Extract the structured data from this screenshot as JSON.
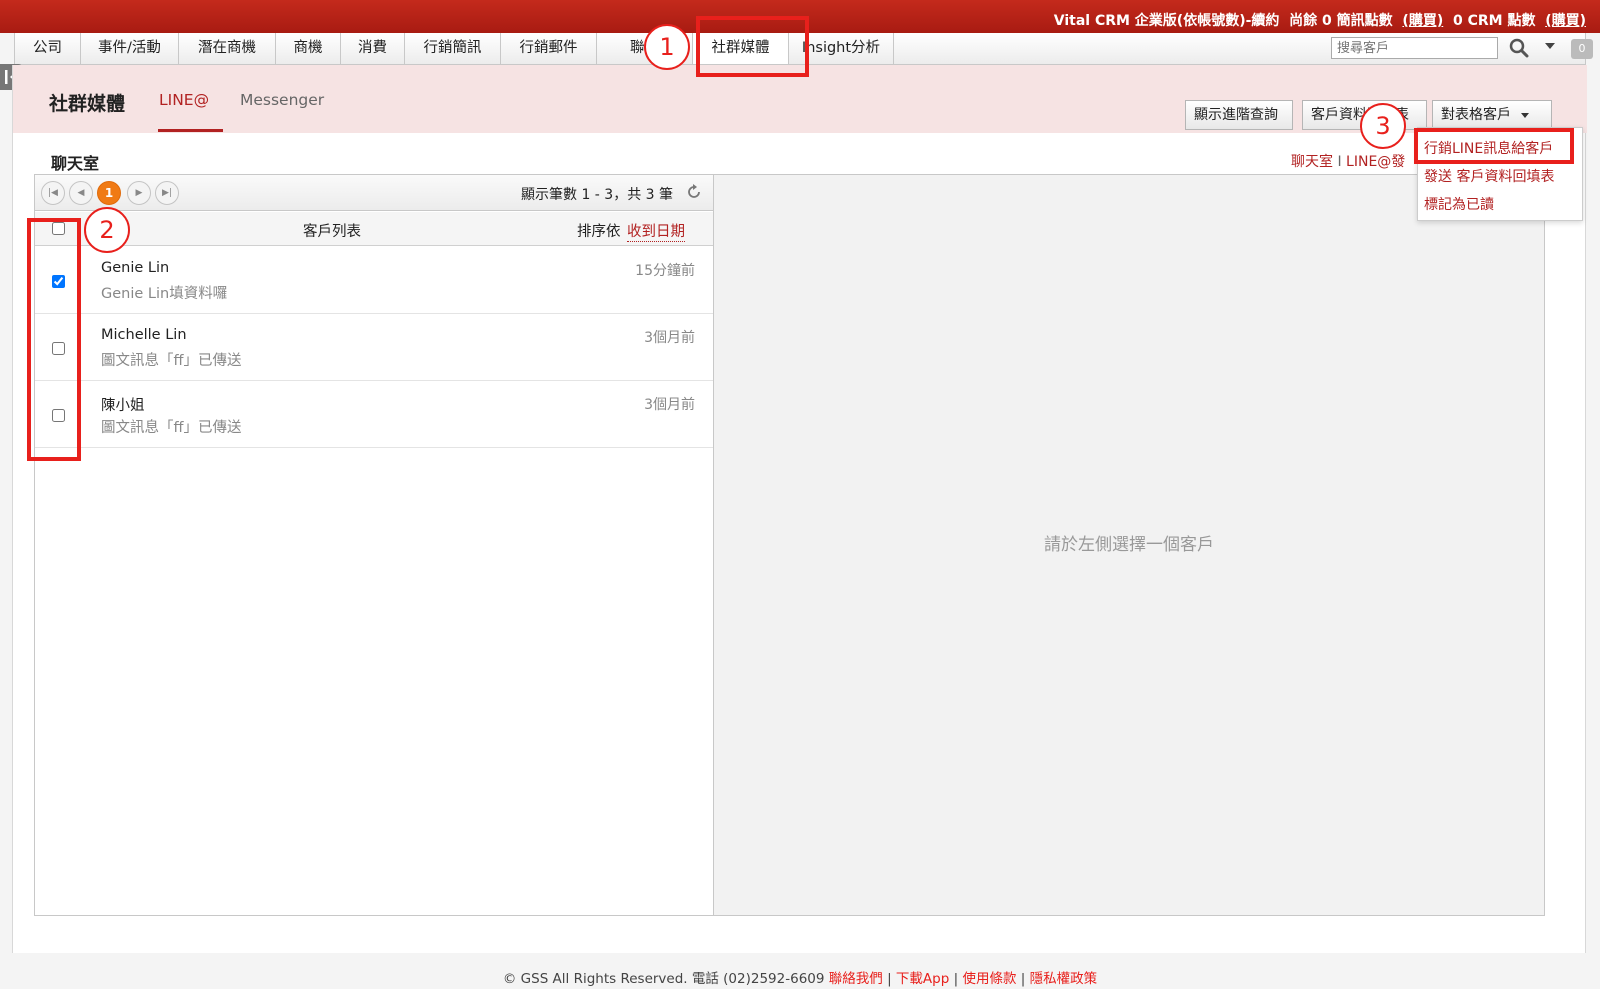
{
  "account": {
    "plan_text": "Vital CRM 企業版(依帳號數)-續約",
    "sms_prefix": "尚餘 0 簡訊點數",
    "buy1": "(購買)",
    "crm_points": "0 CRM 點數",
    "buy2": "(購買)"
  },
  "nav": {
    "tabs": [
      {
        "label": "公司"
      },
      {
        "label": "事件/活動"
      },
      {
        "label": "潛在商機"
      },
      {
        "label": "商機"
      },
      {
        "label": "消費"
      },
      {
        "label": "行銷簡訊"
      },
      {
        "label": "行銷郵件"
      },
      {
        "label": "聯繫"
      },
      {
        "label": "社群媒體"
      },
      {
        "label": "Insight分析"
      }
    ],
    "search_placeholder": "搜尋客戶",
    "badge": "0"
  },
  "subheader": {
    "title": "社群媒體",
    "tabs": [
      {
        "label": "LINE@"
      },
      {
        "label": "Messenger"
      }
    ],
    "buttons": {
      "advanced_query": "顯示進階查詢",
      "customer_form": "客戶資料回填表",
      "bulk_customers": "對表格客戶"
    }
  },
  "chat": {
    "title": "聊天室",
    "crumb": {
      "item1": "聊天室",
      "sep": "I",
      "item2": "LINE@發"
    }
  },
  "pager": {
    "current": "1",
    "count_text": "顯示筆數 1 - 3，共 3 筆"
  },
  "list": {
    "header": "客戶列表",
    "sort_label": "排序依",
    "sort_value": "收到日期",
    "rows": [
      {
        "name": "Genie Lin",
        "message": "Genie Lin填資料囉",
        "time": "15分鐘前",
        "checked": true
      },
      {
        "name": "Michelle Lin",
        "message": "圖文訊息「ff」已傳送",
        "time": "3個月前",
        "checked": false
      },
      {
        "name": "陳小姐",
        "message": "圖文訊息「ff」已傳送",
        "time": "3個月前",
        "checked": false
      }
    ]
  },
  "detail": {
    "empty_text": "請於左側選擇一個客戶"
  },
  "menu": {
    "items": [
      {
        "label": "行銷LINE訊息給客戶"
      },
      {
        "label": "發送 客戶資料回填表"
      },
      {
        "label": "標記為已讀"
      }
    ]
  },
  "annotations": {
    "n1": "1",
    "n2": "2",
    "n3": "3"
  },
  "footer": {
    "text": "© GSS All Rights Reserved. 電話 (02)2592-6609",
    "links": [
      "聯絡我們",
      "下載App",
      "使用條款",
      "隱私權政策"
    ]
  },
  "colors": {
    "brand": "#b22222",
    "annotation": "#e8201c",
    "topbar": "#b5241a"
  }
}
